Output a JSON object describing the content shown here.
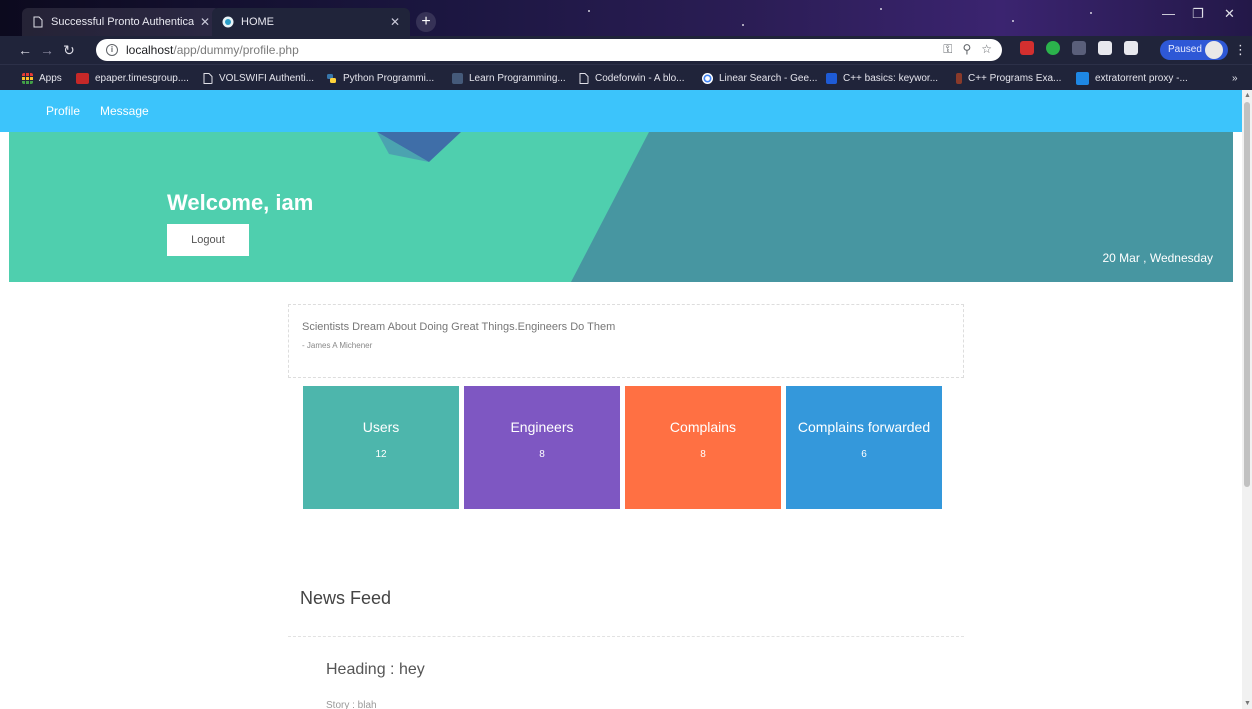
{
  "browser": {
    "tabs": [
      {
        "title": "Successful Pronto Authentication",
        "active": false
      },
      {
        "title": "HOME",
        "active": true
      }
    ],
    "url_host": "localhost",
    "url_path": "/app/dummy/profile.php",
    "paused_label": "Paused",
    "bookmarks": [
      {
        "label": "Apps",
        "icon": "apps-grid-icon"
      },
      {
        "label": "epaper.timesgroup....",
        "icon": "epaper-icon"
      },
      {
        "label": "VOLSWIFI Authenti...",
        "icon": "page-icon"
      },
      {
        "label": "Python Programmi...",
        "icon": "python-icon"
      },
      {
        "label": "Learn Programming...",
        "icon": "learn-icon"
      },
      {
        "label": "Codeforwin - A blo...",
        "icon": "page-icon"
      },
      {
        "label": "Linear Search - Gee...",
        "icon": "google-icon"
      },
      {
        "label": "C++ basics: keywor...",
        "icon": "be-icon"
      },
      {
        "label": "C++ Programs Exa...",
        "icon": "cpp-icon"
      },
      {
        "label": "extratorrent proxy -...",
        "icon": "is-icon"
      }
    ],
    "overflow_label": "»"
  },
  "nav": {
    "items": [
      {
        "label": "Profile"
      },
      {
        "label": "Message"
      }
    ]
  },
  "hero": {
    "welcome": "Welcome, iam",
    "logout_label": "Logout",
    "date": "20 Mar , Wednesday"
  },
  "quote": {
    "text": "Scientists Dream About Doing Great Things.Engineers Do Them",
    "author": "- James A Michener"
  },
  "stats": [
    {
      "label": "Users",
      "value": "12",
      "color": "#4db6ac"
    },
    {
      "label": "Engineers",
      "value": "8",
      "color": "#7e57c2"
    },
    {
      "label": "Complains",
      "value": "8",
      "color": "#ff7043"
    },
    {
      "label": "Complains forwarded",
      "value": "6",
      "color": "#3498db"
    }
  ],
  "news": {
    "title": "News Feed",
    "items": [
      {
        "heading": "Heading : hey",
        "story": "Story : blah"
      }
    ]
  },
  "colors": {
    "nav_bg": "#3cc4fb",
    "hero_light": "#4fcfae",
    "hero_dark": "#4796a1",
    "hero_accent": "#3f6ea8"
  }
}
